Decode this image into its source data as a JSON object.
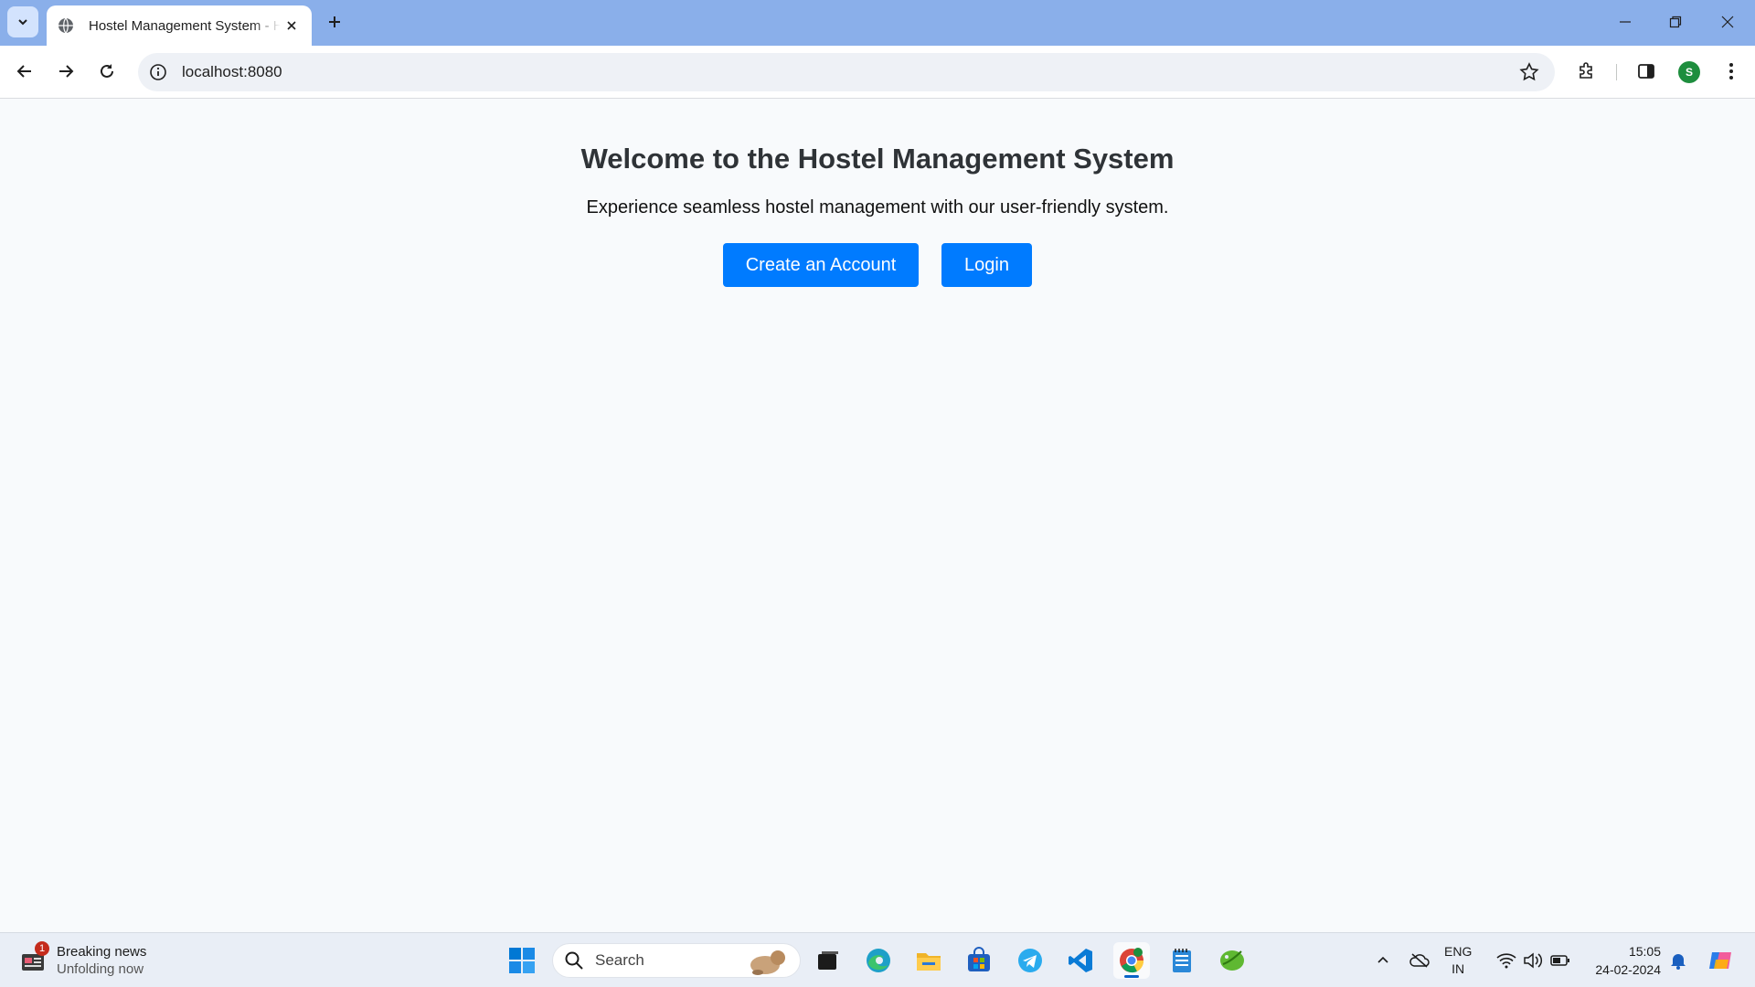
{
  "browser": {
    "tab_title": "Hostel Management System - Home",
    "url": "localhost:8080",
    "profile_initial": "S"
  },
  "page": {
    "title": "Welcome to the Hostel Management System",
    "subtitle": "Experience seamless hostel management with our user-friendly system.",
    "create_account_label": "Create an Account",
    "login_label": "Login",
    "accent_color": "#007bff"
  },
  "taskbar": {
    "news_title": "Breaking news",
    "news_subtitle": "Unfolding now",
    "news_badge": "1",
    "search_placeholder": "Search",
    "apps": [
      "start-icon",
      "task-view-icon",
      "edge-icon",
      "file-explorer-icon",
      "store-icon",
      "telegram-icon",
      "vscode-icon",
      "chrome-icon",
      "notepad-icon",
      "app-icon"
    ],
    "lang_line1": "ENG",
    "lang_line2": "IN",
    "time": "15:05",
    "date": "24-02-2024"
  }
}
